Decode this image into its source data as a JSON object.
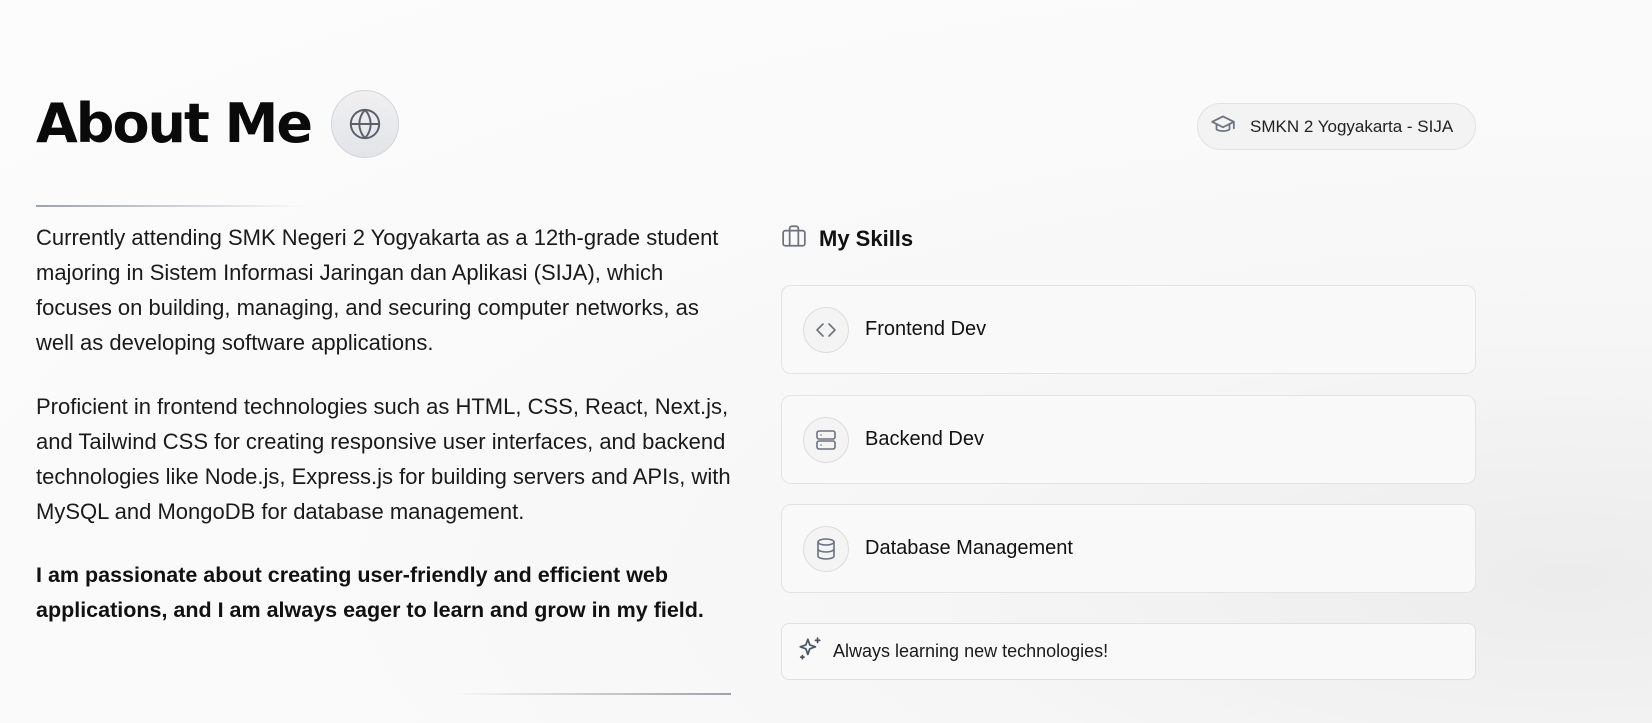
{
  "header": {
    "title": "About Me",
    "globe_icon": "globe-icon"
  },
  "school_badge": {
    "icon": "graduation-cap-icon",
    "label": "SMKN 2 Yogyakarta - SIJA"
  },
  "about": {
    "paragraphs": [
      "Currently attending SMK Negeri 2 Yogyakarta as a 12th-grade student majoring in Sistem Informasi Jaringan dan Aplikasi (SIJA), which focuses on building, managing, and securing computer networks, as well as developing software applications.",
      "Proficient in frontend technologies such as HTML, CSS, React, Next.js, and Tailwind CSS for creating responsive user interfaces, and backend technologies like Node.js, Express.js for building servers and APIs, with MySQL and MongoDB for database management.",
      "I am passionate about creating user-friendly and efficient web applications, and I am always eager to learn and grow in my field."
    ]
  },
  "skills": {
    "heading": "My Skills",
    "heading_icon": "briefcase-icon",
    "items": [
      {
        "label": "Frontend Dev",
        "icon": "code-icon"
      },
      {
        "label": "Backend Dev",
        "icon": "server-icon"
      },
      {
        "label": "Database Management",
        "icon": "database-icon"
      }
    ]
  },
  "note": {
    "icon": "sparkles-icon",
    "text": "Always learning new technologies!"
  },
  "colors": {
    "text": "#111111",
    "icon_gray": "#6b7280",
    "card_border": "#e3e3e3",
    "divider": "#9ea2ab"
  }
}
